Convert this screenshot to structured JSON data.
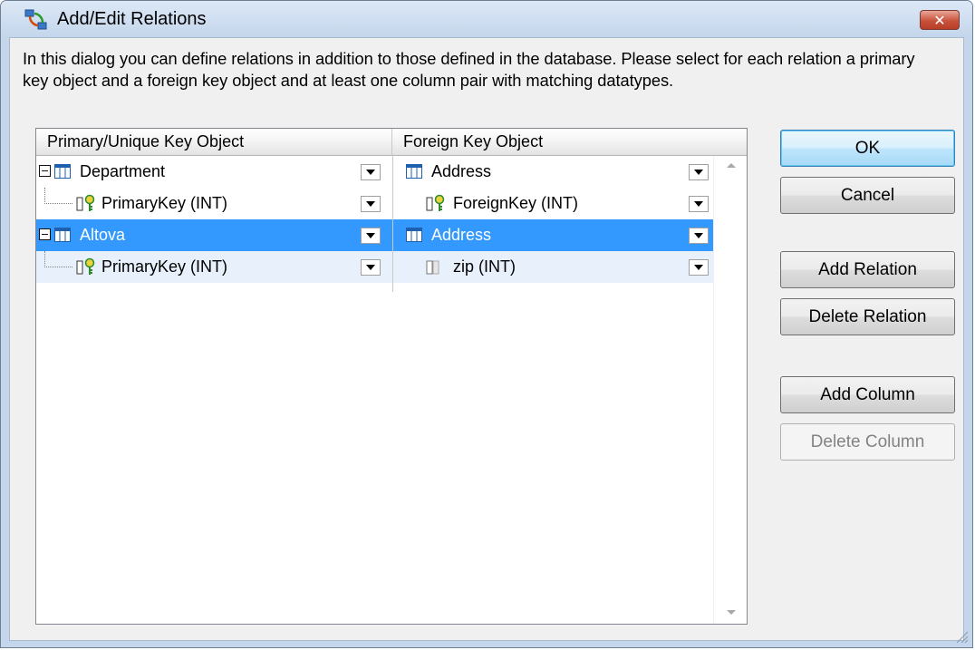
{
  "window": {
    "title": "Add/Edit Relations",
    "close_label": "✕"
  },
  "description": "In this dialog you can define relations in addition to those defined in the database.  Please select for each relation a primary key object and a foreign key object and at least one column pair with matching datatypes.",
  "grid": {
    "columns": [
      "Primary/Unique Key Object",
      "Foreign Key Object"
    ],
    "rows": [
      {
        "primary": "Department",
        "foreign": "Address"
      },
      {
        "primary": "PrimaryKey (INT)",
        "foreign": "ForeignKey (INT)"
      },
      {
        "primary": "Altova",
        "foreign": "Address"
      },
      {
        "primary": "PrimaryKey (INT)",
        "foreign": "zip (INT)"
      }
    ]
  },
  "buttons": {
    "ok": "OK",
    "cancel": "Cancel",
    "add_relation": "Add Relation",
    "delete_relation": "Delete Relation",
    "add_column": "Add Column",
    "delete_column": "Delete Column"
  },
  "colors": {
    "selection": "#3399ff",
    "title_bar": "#c4d6ec",
    "close_button": "#c8523c"
  },
  "icons": [
    "relations-app-icon",
    "close-icon",
    "table-icon",
    "key-column-icon",
    "column-icon",
    "dropdown-arrow-icon",
    "resize-grip-icon"
  ]
}
